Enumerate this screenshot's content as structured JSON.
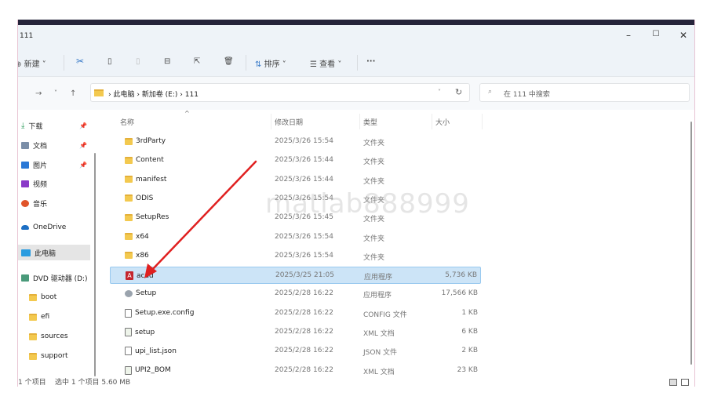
{
  "window": {
    "title": "111",
    "minimize": "–",
    "maximize": "☐",
    "close": "✕"
  },
  "toolbar": {
    "new_label": "新建",
    "sort_label": "排序",
    "view_label": "查看",
    "more_label": "···"
  },
  "address": {
    "path": [
      "此电脑",
      "新加卷 (E:)",
      "111"
    ],
    "search_placeholder": "在 111 中搜索"
  },
  "sidebar": {
    "items": [
      {
        "label": "下载",
        "icon": "download-icon",
        "pinned": true
      },
      {
        "label": "文档",
        "icon": "document-icon",
        "pinned": true
      },
      {
        "label": "图片",
        "icon": "pictures-icon",
        "pinned": true
      },
      {
        "label": "视频",
        "icon": "video-icon"
      },
      {
        "label": "音乐",
        "icon": "music-icon"
      },
      {
        "label": "OneDrive",
        "icon": "cloud-icon"
      },
      {
        "label": "此电脑",
        "icon": "computer-icon",
        "selected": true
      },
      {
        "label": "DVD 驱动器 (D:)",
        "icon": "dvd-icon"
      },
      {
        "label": "boot",
        "icon": "folder-icon"
      },
      {
        "label": "efi",
        "icon": "folder-icon"
      },
      {
        "label": "sources",
        "icon": "folder-icon"
      },
      {
        "label": "support",
        "icon": "folder-icon"
      }
    ]
  },
  "columns": {
    "name": "名称",
    "date": "修改日期",
    "type": "类型",
    "size": "大小"
  },
  "files": [
    {
      "name": "3rdParty",
      "date": "2025/3/26 15:54",
      "type": "文件夹",
      "size": "",
      "icon": "folder-icon"
    },
    {
      "name": "Content",
      "date": "2025/3/26 15:44",
      "type": "文件夹",
      "size": "",
      "icon": "folder-icon"
    },
    {
      "name": "manifest",
      "date": "2025/3/26 15:44",
      "type": "文件夹",
      "size": "",
      "icon": "folder-icon"
    },
    {
      "name": "ODIS",
      "date": "2025/3/26 15:54",
      "type": "文件夹",
      "size": "",
      "icon": "folder-icon"
    },
    {
      "name": "SetupRes",
      "date": "2025/3/26 15:45",
      "type": "文件夹",
      "size": "",
      "icon": "folder-icon"
    },
    {
      "name": "x64",
      "date": "2025/3/26 15:54",
      "type": "文件夹",
      "size": "",
      "icon": "folder-icon"
    },
    {
      "name": "x86",
      "date": "2025/3/26 15:54",
      "type": "文件夹",
      "size": "",
      "icon": "folder-icon"
    },
    {
      "name": "acad",
      "date": "2025/3/25 21:05",
      "type": "应用程序",
      "size": "5,736 KB",
      "icon": "autocad-icon",
      "selected": true
    },
    {
      "name": "Setup",
      "date": "2025/2/28 16:22",
      "type": "应用程序",
      "size": "17,566 KB",
      "icon": "setup-icon"
    },
    {
      "name": "Setup.exe.config",
      "date": "2025/2/28 16:22",
      "type": "CONFIG 文件",
      "size": "1 KB",
      "icon": "file-icon"
    },
    {
      "name": "setup",
      "date": "2025/2/28 16:22",
      "type": "XML 文档",
      "size": "6 KB",
      "icon": "xml-icon"
    },
    {
      "name": "upi_list.json",
      "date": "2025/2/28 16:22",
      "type": "JSON 文件",
      "size": "2 KB",
      "icon": "file-icon"
    },
    {
      "name": "UPI2_BOM",
      "date": "2025/2/28 16:22",
      "type": "XML 文档",
      "size": "23 KB",
      "icon": "xml-icon"
    }
  ],
  "status": {
    "count": "1 个项目",
    "selected": "选中 1 个项目 5.60 MB"
  },
  "watermark": "matlab888999",
  "colors": {
    "selection": "#cce4f7",
    "arrow": "#e02020",
    "folder": "#f3c94f"
  }
}
